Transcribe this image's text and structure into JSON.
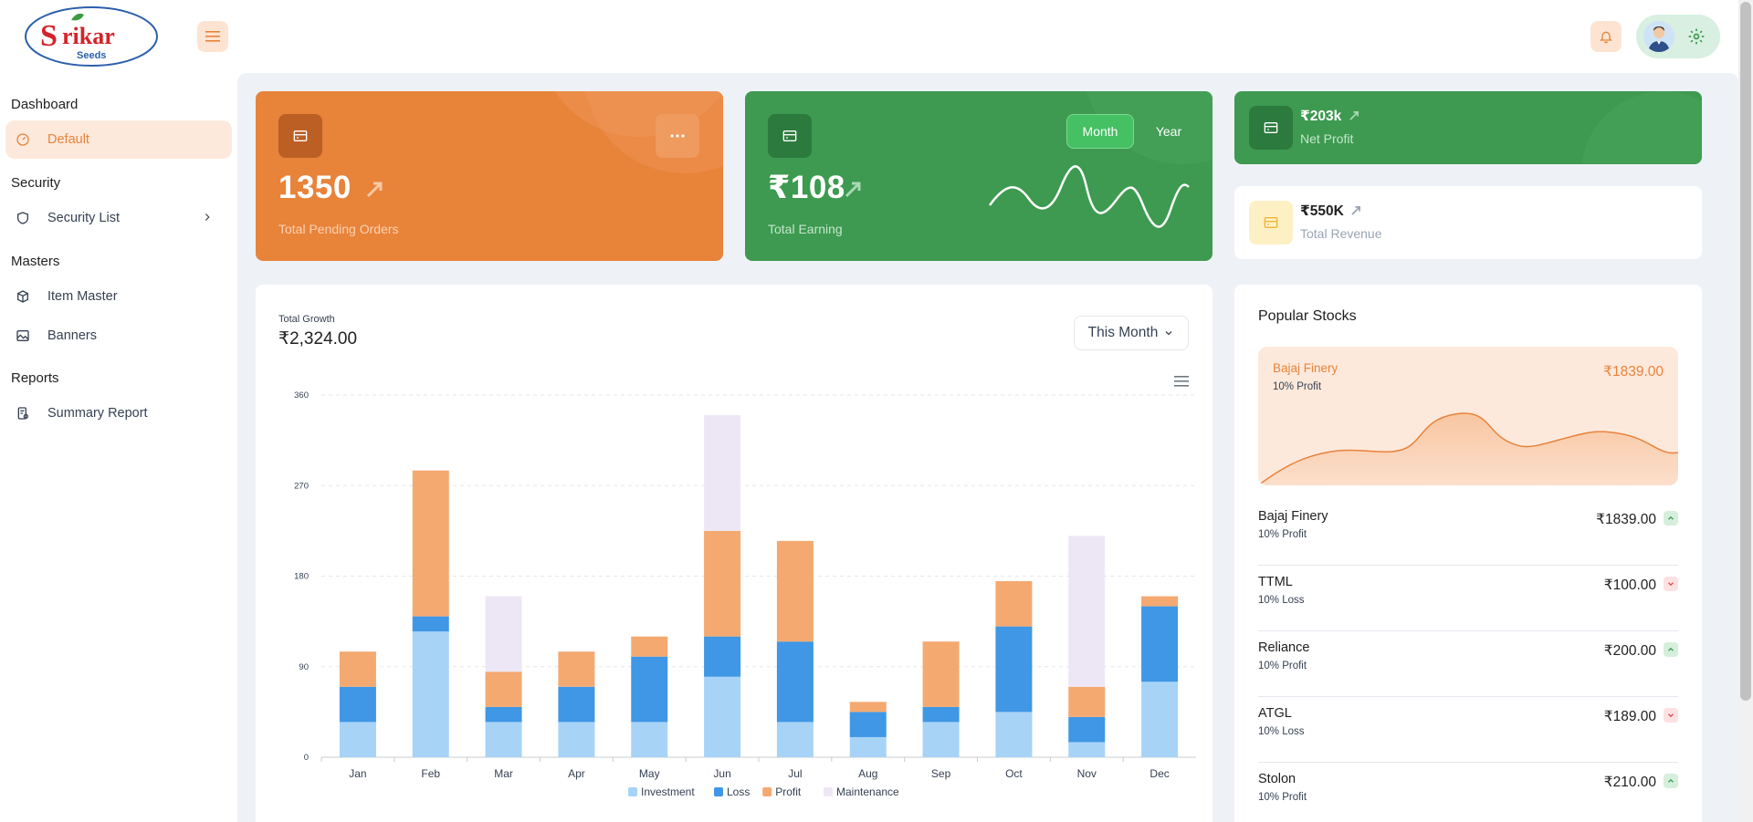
{
  "brand": {
    "name": "Srikar",
    "tagline": "Seeds"
  },
  "sidebar": {
    "sections": [
      {
        "title": "Dashboard",
        "items": [
          {
            "label": "Default",
            "icon": "dashboard-icon",
            "active": true
          }
        ]
      },
      {
        "title": "Security",
        "items": [
          {
            "label": "Security List",
            "icon": "shield-icon",
            "has_children": true
          }
        ]
      },
      {
        "title": "Masters",
        "items": [
          {
            "label": "Item Master",
            "icon": "box-icon"
          },
          {
            "label": "Banners",
            "icon": "image-icon"
          }
        ]
      },
      {
        "title": "Reports",
        "items": [
          {
            "label": "Summary Report",
            "icon": "report-icon"
          }
        ]
      }
    ]
  },
  "cards": {
    "pending": {
      "value": "1350",
      "label": "Total Pending Orders"
    },
    "earning": {
      "value": "₹108",
      "label": "Total Earning",
      "toggle_month": "Month",
      "toggle_year": "Year"
    },
    "net_profit": {
      "value": "₹203k",
      "label": "Net Profit"
    },
    "revenue": {
      "value": "₹550K",
      "label": "Total Revenue"
    }
  },
  "growth": {
    "title": "Total Growth",
    "amount": "₹2,324.00",
    "period": "This Month"
  },
  "chart_data": {
    "type": "bar",
    "stacked": true,
    "categories": [
      "Jan",
      "Feb",
      "Mar",
      "Apr",
      "May",
      "Jun",
      "Jul",
      "Aug",
      "Sep",
      "Oct",
      "Nov",
      "Dec"
    ],
    "series": [
      {
        "name": "Investment",
        "color": "#a7d3f7",
        "values": [
          35,
          125,
          35,
          35,
          35,
          80,
          35,
          20,
          35,
          45,
          15,
          75
        ]
      },
      {
        "name": "Loss",
        "color": "#3f97e5",
        "values": [
          35,
          15,
          15,
          35,
          65,
          40,
          80,
          25,
          15,
          85,
          25,
          75
        ]
      },
      {
        "name": "Profit",
        "color": "#f4a971",
        "values": [
          35,
          145,
          35,
          35,
          20,
          105,
          100,
          10,
          65,
          45,
          30,
          10
        ]
      },
      {
        "name": "Maintenance",
        "color": "#ede7f5",
        "values": [
          0,
          0,
          75,
          0,
          0,
          115,
          0,
          0,
          0,
          0,
          150,
          0
        ]
      }
    ],
    "yticks": [
      "0",
      "90",
      "180",
      "270",
      "360"
    ],
    "ylim": [
      0,
      360
    ],
    "grid": true,
    "legend": "bottom"
  },
  "stocks": {
    "title": "Popular Stocks",
    "featured": {
      "name": "Bajaj Finery",
      "sub": "10% Profit",
      "price": "₹1839.00"
    },
    "rows": [
      {
        "name": "Bajaj Finery",
        "sub": "10% Profit",
        "price": "₹1839.00",
        "trend": "up"
      },
      {
        "name": "TTML",
        "sub": "10% Loss",
        "price": "₹100.00",
        "trend": "down"
      },
      {
        "name": "Reliance",
        "sub": "10% Profit",
        "price": "₹200.00",
        "trend": "up"
      },
      {
        "name": "ATGL",
        "sub": "10% Loss",
        "price": "₹189.00",
        "trend": "down"
      },
      {
        "name": "Stolon",
        "sub": "10% Profit",
        "price": "₹210.00",
        "trend": "up"
      }
    ]
  },
  "colors": {
    "accent": "#e8833a",
    "green": "#3d9a50",
    "sidebar_active_bg": "#fde9dc"
  }
}
